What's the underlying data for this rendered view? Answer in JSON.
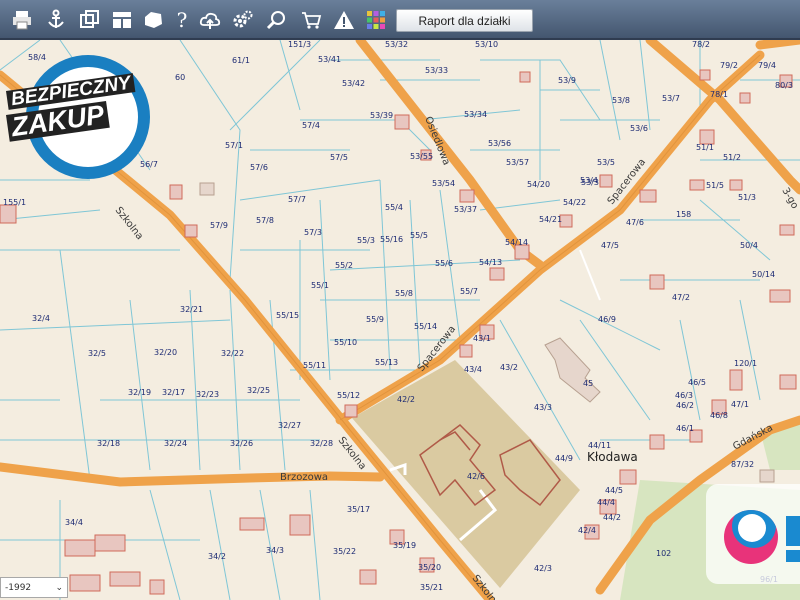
{
  "toolbar": {
    "buttons": [
      "print-icon",
      "anchor-icon",
      "layers-icon",
      "layout-icon",
      "shape-icon",
      "help-icon",
      "cloud-upload-icon",
      "settings-icon",
      "zoom-icon",
      "cart-icon",
      "warning-icon",
      "color-grid-icon"
    ],
    "help_glyph": "?",
    "report_button": "Raport dla działki"
  },
  "badge": {
    "line1": "BEZPIECZNY",
    "line2": "ZAKUP"
  },
  "map": {
    "streets": [
      "Szkolna",
      "Szkolna",
      "Szkolna",
      "Osiedlowa",
      "Spacerowa",
      "Spacerowa",
      "Brzozowa",
      "Gdańska",
      "3-go"
    ],
    "town": "Kłodawa",
    "parcels": [
      "58/4",
      "60",
      "61/1",
      "151/3",
      "53/41",
      "53/32",
      "53/10",
      "53/42",
      "53/33",
      "53/9",
      "78/2",
      "79/2",
      "79/4",
      "80/3",
      "78/1",
      "56/7",
      "57/1",
      "57/4",
      "53/39",
      "53/34",
      "53/8",
      "53/7",
      "53/6",
      "57/6",
      "57/5",
      "53/55",
      "53/56",
      "53/57",
      "53/5",
      "51/1",
      "51/2",
      "155/1",
      "57/9",
      "57/7",
      "53/54",
      "53/37",
      "54/20",
      "53/4",
      "53/3",
      "54/21",
      "54/22",
      "51/5",
      "51/3",
      "57/8",
      "57/3",
      "55/4",
      "55/3",
      "55/16",
      "55/5",
      "47/6",
      "158",
      "47/5",
      "50/4",
      "54/14",
      "54/13",
      "55/2",
      "55/6",
      "50/14",
      "55/1",
      "55/8",
      "55/7",
      "47/2",
      "32/4",
      "32/21",
      "55/15",
      "55/9",
      "55/14",
      "46/9",
      "43/1",
      "32/5",
      "32/20",
      "32/22",
      "55/10",
      "55/11",
      "55/13",
      "43/4",
      "43/2",
      "120/1",
      "45",
      "32/19",
      "32/17",
      "32/23",
      "32/25",
      "55/12",
      "42/2",
      "46/5",
      "46/3",
      "43/3",
      "46/2",
      "47/1",
      "46/8",
      "32/18",
      "32/24",
      "32/26",
      "32/27",
      "32/28",
      "46/1",
      "44/11",
      "44/9",
      "87/32",
      "42/6",
      "44/5",
      "44/4",
      "44/2",
      "34/4",
      "35/17",
      "35/19",
      "35/22",
      "42/4",
      "34/2",
      "34/3",
      "42/3",
      "35/20",
      "35/21",
      "102",
      "96/1"
    ],
    "scale_select": "-1992"
  }
}
